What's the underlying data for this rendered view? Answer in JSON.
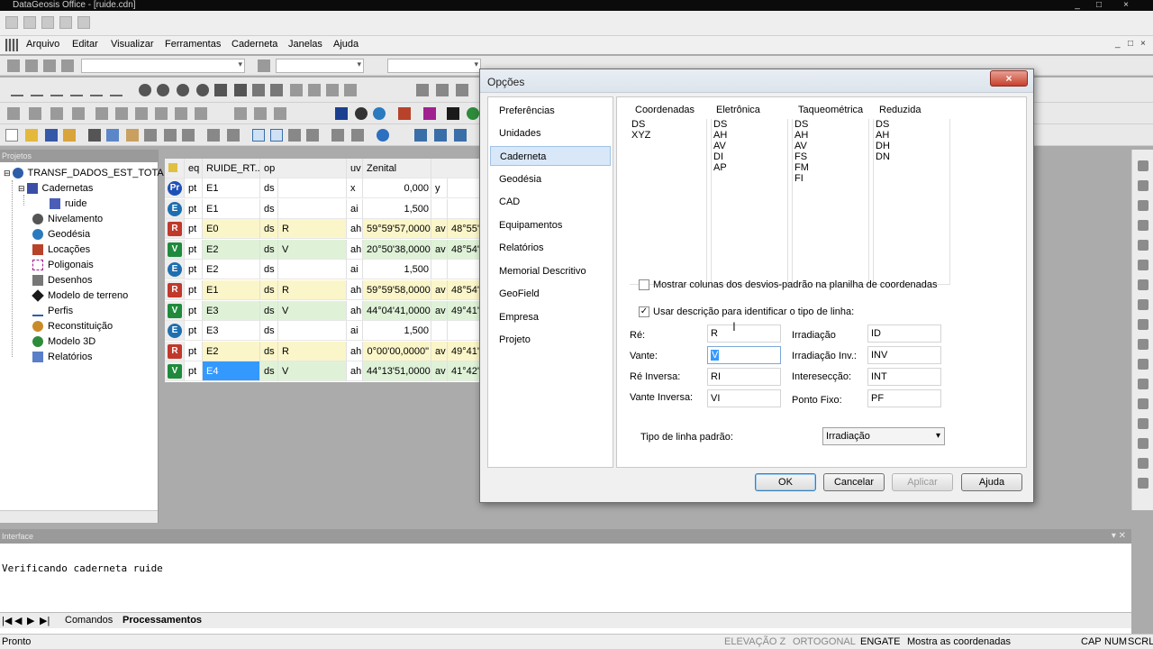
{
  "window": {
    "title": "DataGeosis Office - [ruide.cdn]",
    "controls": [
      "_",
      "□",
      "×"
    ]
  },
  "menu": {
    "items": [
      "Arquivo",
      "Editar",
      "Visualizar",
      "Ferramentas",
      "Caderneta",
      "Janelas",
      "Ajuda"
    ],
    "mdi_controls": [
      "_",
      "□",
      "×"
    ]
  },
  "project_panel": {
    "title": "Projetos",
    "root": "TRANSF_DADOS_EST_TOTA",
    "items": {
      "cadernetas": "Cadernetas",
      "ruide": "ruide",
      "nivelamento": "Nivelamento",
      "geodesia": "Geodésia",
      "locacoes": "Locações",
      "poligonais": "Poligonais",
      "desenhos": "Desenhos",
      "modelo_terreno": "Modelo de terreno",
      "perfis": "Perfis",
      "reconstituicao": "Reconstituição",
      "modelo_3d": "Modelo 3D",
      "relatorios": "Relatórios"
    }
  },
  "grid": {
    "headers": {
      "eq": "eq",
      "name": "RUIDE_RT...",
      "op": "op",
      "uv": "uv",
      "zenital": "Zenital"
    },
    "rows": [
      {
        "icon": "Pr",
        "color": "#1e4fb8",
        "shape": "round",
        "eq": "pt",
        "name": "E1",
        "op": "ds",
        "op2": "",
        "uv": "x",
        "val": "0,000",
        "extra": "y",
        "extra2": "",
        "hl": ""
      },
      {
        "icon": "E",
        "color": "#1f6fb0",
        "shape": "round",
        "eq": "pt",
        "name": "E1",
        "op": "ds",
        "op2": "",
        "uv": "ai",
        "val": "1,500",
        "extra": "",
        "extra2": "",
        "hl": ""
      },
      {
        "icon": "R",
        "color": "#c0392b",
        "shape": "square",
        "eq": "pt",
        "name": "E0",
        "op": "ds",
        "op2": "R",
        "uv": "ah",
        "val": "59°59'57,0000\"",
        "extra": "av",
        "extra2": "48°55'",
        "hl": "y"
      },
      {
        "icon": "V",
        "color": "#1f8a3c",
        "shape": "square",
        "eq": "pt",
        "name": "E2",
        "op": "ds",
        "op2": "V",
        "uv": "ah",
        "val": "20°50'38,0000\"",
        "extra": "av",
        "extra2": "48°54'",
        "hl": "g"
      },
      {
        "icon": "E",
        "color": "#1f6fb0",
        "shape": "round",
        "eq": "pt",
        "name": "E2",
        "op": "ds",
        "op2": "",
        "uv": "ai",
        "val": "1,500",
        "extra": "",
        "extra2": "",
        "hl": ""
      },
      {
        "icon": "R",
        "color": "#c0392b",
        "shape": "square",
        "eq": "pt",
        "name": "E1",
        "op": "ds",
        "op2": "R",
        "uv": "ah",
        "val": "59°59'58,0000\"",
        "extra": "av",
        "extra2": "48°54'",
        "hl": "y"
      },
      {
        "icon": "V",
        "color": "#1f8a3c",
        "shape": "square",
        "eq": "pt",
        "name": "E3",
        "op": "ds",
        "op2": "V",
        "uv": "ah",
        "val": "44°04'41,0000\"",
        "extra": "av",
        "extra2": "49°41'",
        "hl": "g"
      },
      {
        "icon": "E",
        "color": "#1f6fb0",
        "shape": "round",
        "eq": "pt",
        "name": "E3",
        "op": "ds",
        "op2": "",
        "uv": "ai",
        "val": "1,500",
        "extra": "",
        "extra2": "",
        "hl": ""
      },
      {
        "icon": "R",
        "color": "#c0392b",
        "shape": "square",
        "eq": "pt",
        "name": "E2",
        "op": "ds",
        "op2": "R",
        "uv": "ah",
        "val": "0°00'00,0000\"",
        "extra": "av",
        "extra2": "49°41'",
        "hl": "y"
      },
      {
        "icon": "V",
        "color": "#1f8a3c",
        "shape": "square",
        "eq": "pt",
        "name": "E4",
        "op": "ds",
        "op2": "V",
        "uv": "ah",
        "val": "44°13'51,0000\"",
        "extra": "av",
        "extra2": "41°42'",
        "hl": "g",
        "selected": true
      }
    ]
  },
  "dialog": {
    "title": "Opções",
    "close_label": "×",
    "nav": [
      "Preferências",
      "Unidades",
      "Caderneta",
      "Geodésia",
      "CAD",
      "Equipamentos",
      "Relatórios",
      "Memorial Descritivo",
      "GeoField",
      "Empresa",
      "Projeto"
    ],
    "selected_nav": "Caderneta",
    "columns": [
      {
        "header": "Coordenadas",
        "items": [
          "DS",
          "XYZ"
        ]
      },
      {
        "header": "Eletrônica",
        "items": [
          "DS",
          "AH",
          "AV",
          "DI",
          "AP"
        ]
      },
      {
        "header": "Taqueométrica",
        "items": [
          "DS",
          "AH",
          "AV",
          "FS",
          "FM",
          "FI"
        ]
      },
      {
        "header": "Reduzida",
        "items": [
          "DS",
          "AH",
          "DH",
          "DN"
        ]
      }
    ],
    "chk_desvios": "Mostrar colunas dos desvios-padrão na planilha de coordenadas",
    "chk_desvios_checked": false,
    "chk_descricao": "Usar descrição para identificar o tipo de linha:",
    "chk_descricao_checked": true,
    "fields": {
      "re": {
        "label": "Ré:",
        "value": "R"
      },
      "vante": {
        "label": "Vante:",
        "value": "V"
      },
      "re_inversa": {
        "label": "Ré Inversa:",
        "value": "RI"
      },
      "vante_inversa": {
        "label": "Vante Inversa:",
        "value": "VI"
      },
      "irradiacao": {
        "label": "Irradiação",
        "value": "ID"
      },
      "irradiacao_inv": {
        "label": "Irradiação Inv.:",
        "value": "INV"
      },
      "intersecao": {
        "label": "Interesecção:",
        "value": "INT"
      },
      "ponto_fixo": {
        "label": "Ponto Fixo:",
        "value": "PF"
      }
    },
    "tipo_linha_label": "Tipo de linha padrão:",
    "tipo_linha_value": "Irradiação",
    "buttons": {
      "ok": "OK",
      "cancel": "Cancelar",
      "apply": "Aplicar",
      "help": "Ajuda"
    }
  },
  "interface_panel": {
    "title": "Interface",
    "console": "Verificando caderneta ruide",
    "tabs": [
      "Comandos",
      "Processamentos"
    ],
    "active_tab": "Processamentos",
    "nav_arrows": [
      "|◀",
      "◀",
      "▶",
      "▶|"
    ]
  },
  "status": {
    "left": "Pronto",
    "items": [
      "ELEVAÇÃO Z",
      "ORTOGONAL",
      "ENGATE",
      "Mostra as coordenadas",
      "CAP",
      "NUM",
      "SCRL"
    ]
  }
}
